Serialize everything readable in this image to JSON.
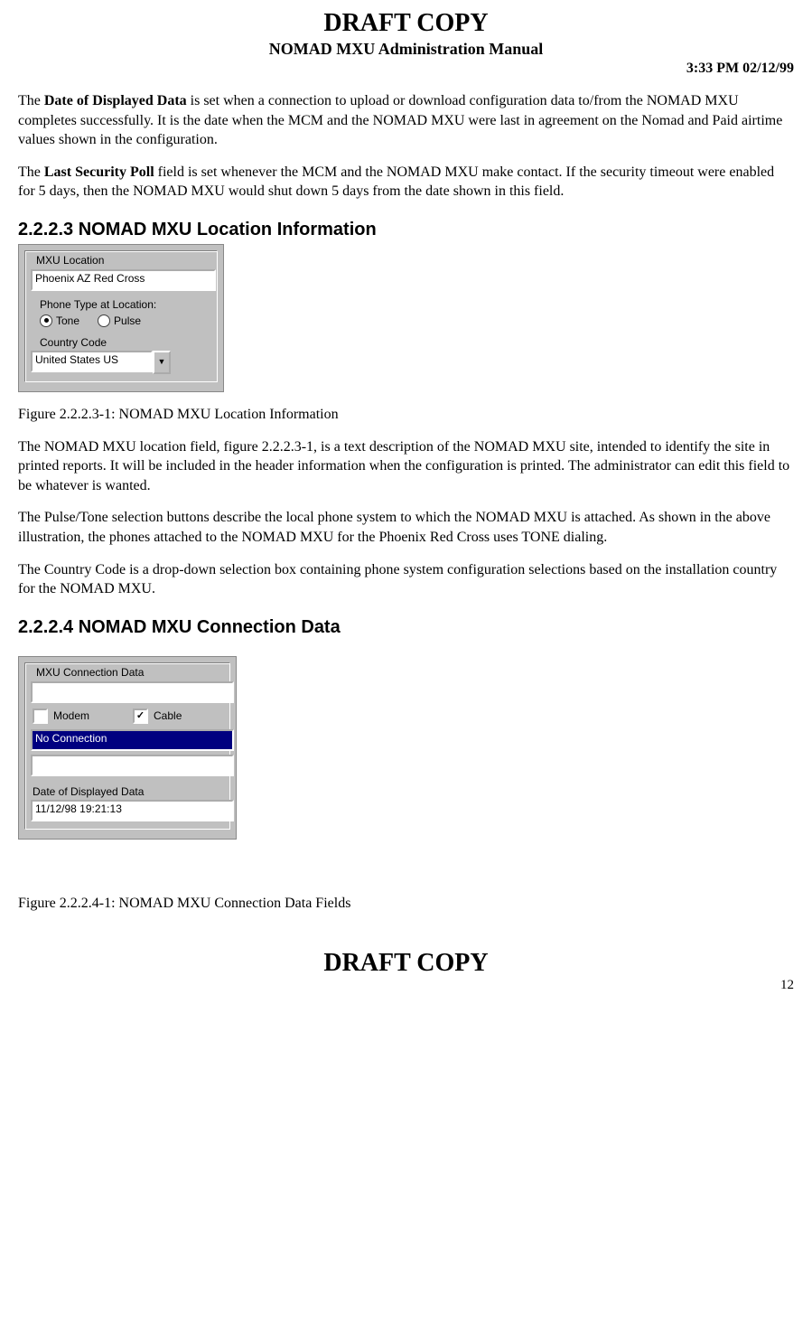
{
  "header": {
    "draft": "DRAFT COPY",
    "subtitle": "NOMAD MXU Administration Manual",
    "timestamp": "3:33 PM  02/12/99"
  },
  "paras": {
    "p1a": "The ",
    "p1b": "Date of Displayed Data",
    "p1c": " is set when a connection to upload or download configuration data to/from the NOMAD MXU completes successfully.  It is the date when the MCM and the NOMAD MXU were last in agreement on the Nomad and Paid airtime values shown in the configuration.",
    "p2a": "The ",
    "p2b": "Last Security Poll",
    "p2c": " field is set whenever the MCM and the NOMAD MXU make contact.   If the security timeout were enabled for 5 days, then the NOMAD MXU would shut down 5 days from the date shown in this field.",
    "fig1": "Figure 2.2.2.3-1:  NOMAD MXU Location Information",
    "p3": "The NOMAD MXU location field, figure 2.2.2.3-1,  is a text description of the NOMAD MXU site, intended to identify the site in printed reports.  It will be included in the header information when the configuration is printed.    The administrator can edit this field to be whatever is wanted.",
    "p4": "The Pulse/Tone selection buttons describe the local phone system to which the NOMAD MXU is attached.  As shown in the above illustration, the phones attached to the NOMAD MXU for the Phoenix Red Cross uses TONE dialing.",
    "p5": "The Country Code is a drop-down selection box containing phone system configuration selections based on the installation country for the NOMAD MXU.",
    "fig2": "Figure 2.2.2.4-1: NOMAD MXU Connection Data Fields"
  },
  "headings": {
    "h2223": "2.2.2.3  NOMAD MXU Location Information",
    "h2224": "2.2.2.4  NOMAD MXU Connection Data"
  },
  "loc_panel": {
    "legend": "MXU Location",
    "location_value": "Phoenix AZ Red Cross",
    "phone_type_label": "Phone Type at Location:",
    "tone": "Tone",
    "pulse": "Pulse",
    "cc_label": "Country Code",
    "cc_value": "United States US"
  },
  "conn_panel": {
    "legend": "MXU Connection Data",
    "top_value": "",
    "modem": "Modem",
    "cable": "Cable",
    "status": "No Connection",
    "blank_value": "",
    "dod_label": "Date of Displayed Data",
    "dod_value": "11/12/98 19:21:13"
  },
  "footer": {
    "draft": "DRAFT COPY",
    "page": "12"
  }
}
